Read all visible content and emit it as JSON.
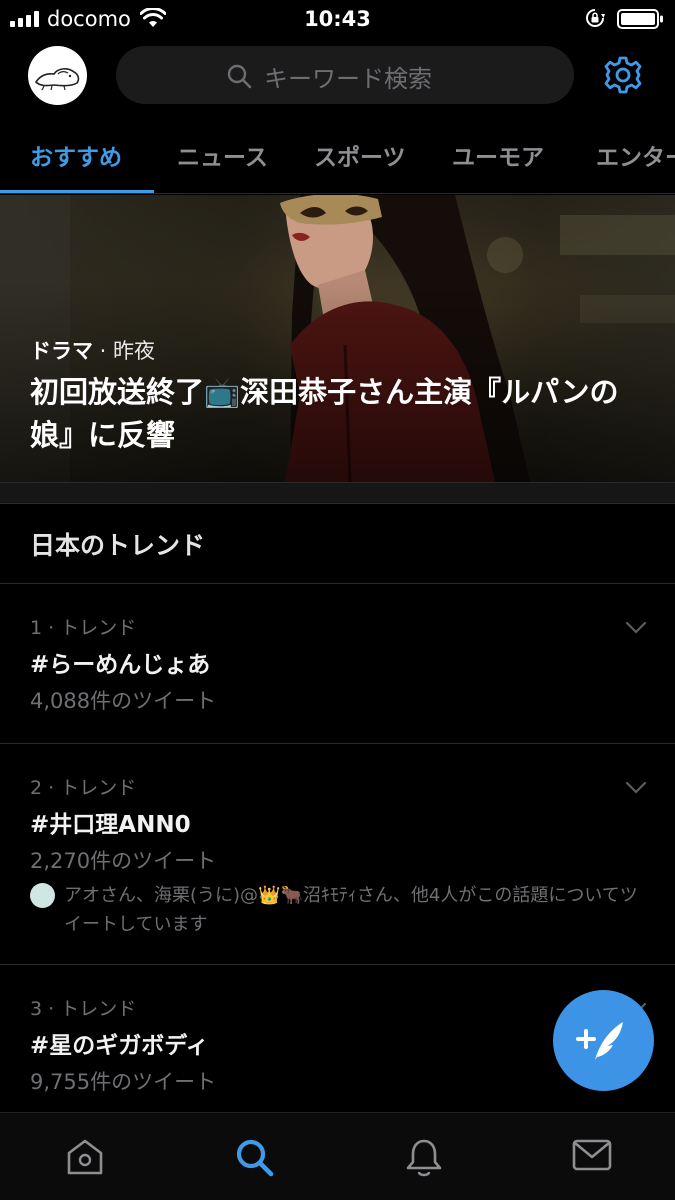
{
  "status_bar": {
    "carrier": "docomo",
    "time": "10:43"
  },
  "header": {
    "search_placeholder": "キーワード検索"
  },
  "tabs": [
    {
      "label": "おすすめ",
      "active": true
    },
    {
      "label": "ニュース",
      "active": false
    },
    {
      "label": "スポーツ",
      "active": false
    },
    {
      "label": "ユーモア",
      "active": false
    },
    {
      "label": "エンター",
      "active": false
    }
  ],
  "hero": {
    "category": "ドラマ",
    "separator": " · ",
    "time": "昨夜",
    "headline": "初回放送終了📺深田恭子さん主演『ルパンの娘』に反響"
  },
  "section": {
    "title": "日本のトレンド"
  },
  "trends": [
    {
      "rank": "1 · トレンド",
      "name": "#らーめんじょあ",
      "count": "4,088件のツイート",
      "context": ""
    },
    {
      "rank": "2 · トレンド",
      "name": "#井口理ANN0",
      "count": "2,270件のツイート",
      "context": "アオさん、海栗(うに)@👑🐂沼ｷﾓﾃｨさん、他4人がこの話題についてツイートしています"
    },
    {
      "rank": "3 · トレンド",
      "name": "#星のギガボディ",
      "count": "9,755件のツイート",
      "context": ""
    }
  ],
  "colors": {
    "accent": "#3f9ae8",
    "background": "#000000",
    "muted_text": "#6f6f74"
  },
  "icons": {
    "fab": "compose-tweet-icon",
    "tabbar": [
      "home-icon",
      "search-icon",
      "notifications-icon",
      "messages-icon"
    ]
  }
}
